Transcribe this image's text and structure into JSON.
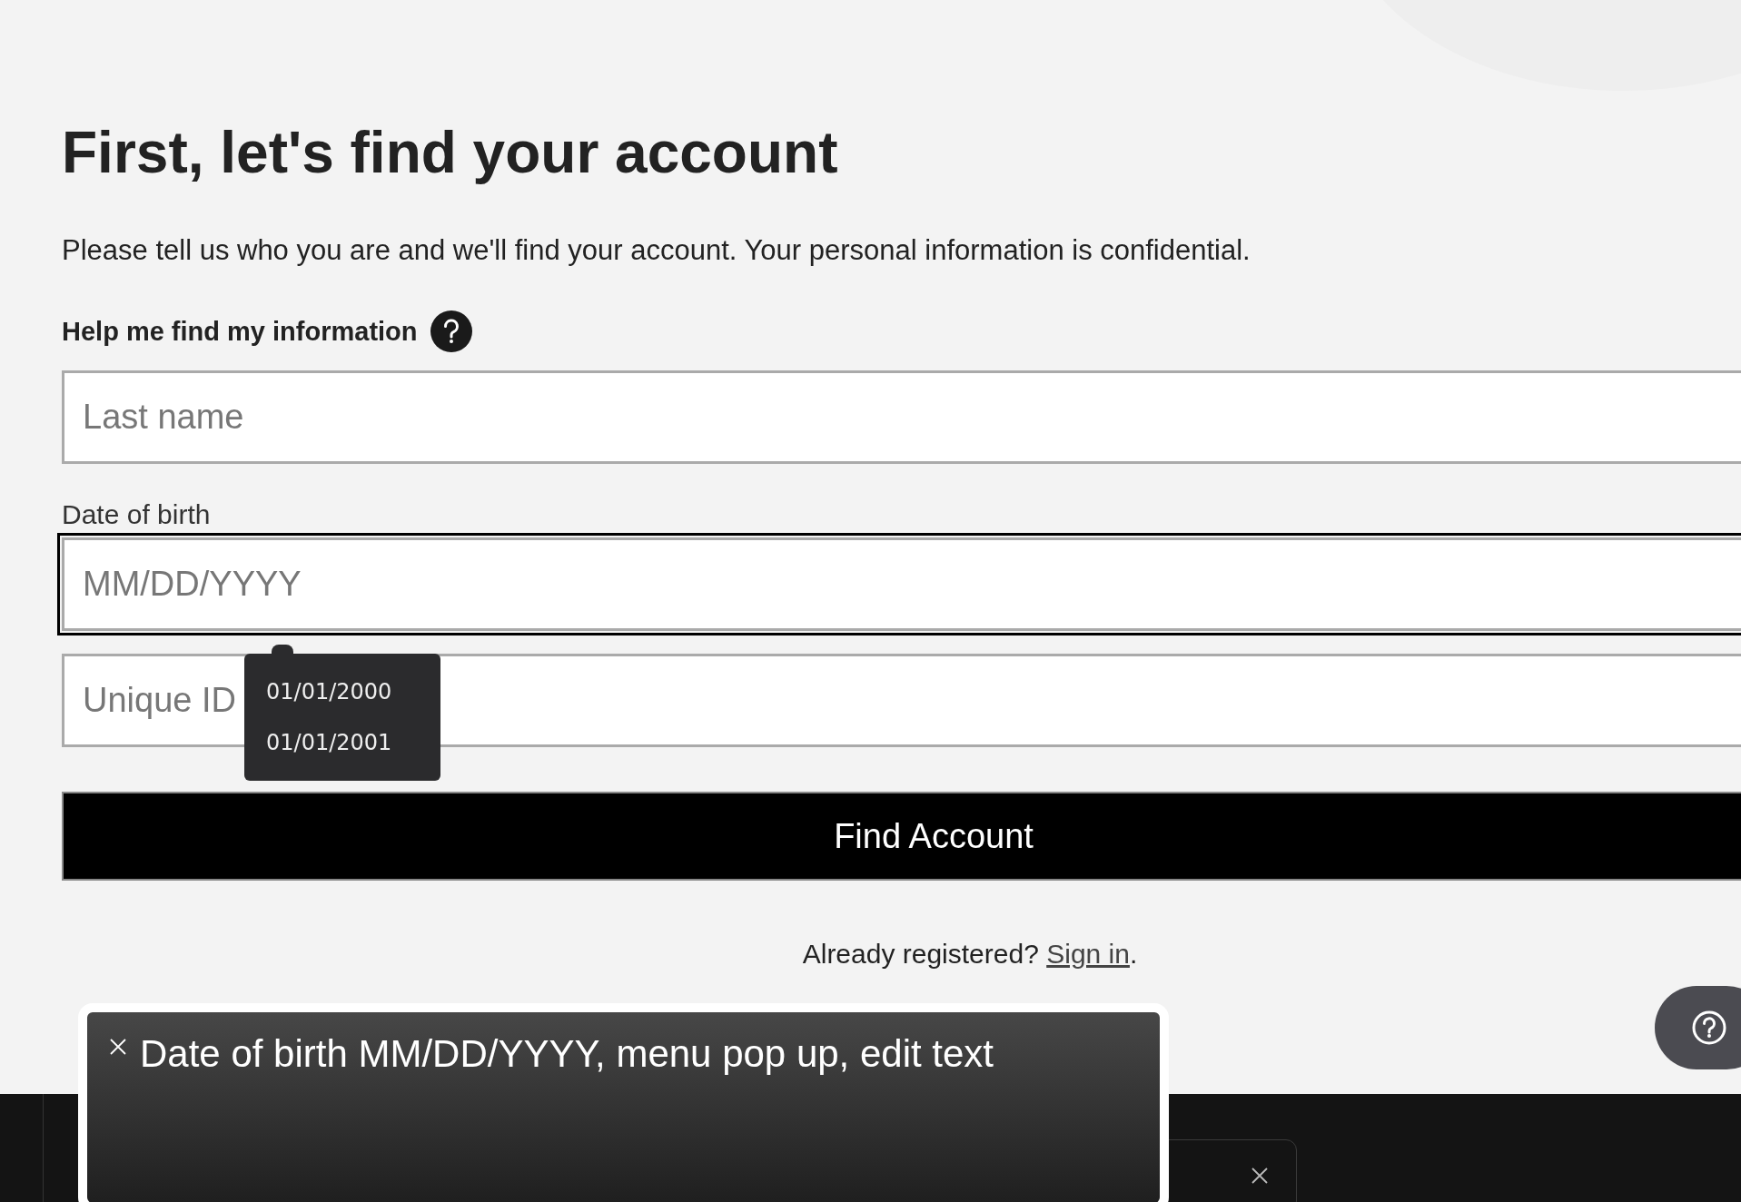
{
  "heading": "First, let's find your account",
  "intro": "Please tell us who you are and we'll find your account. Your personal information is confidential.",
  "help_label": "Help me find my information",
  "fields": [
    {
      "placeholder": "Last name",
      "focused": false
    },
    {
      "label": "Date of birth",
      "placeholder": "MM/DD/YYYY",
      "focused": true,
      "suggestions": [
        "01/01/2000",
        "01/01/2001"
      ]
    },
    {
      "placeholder": "Unique ID",
      "focused": false
    }
  ],
  "button": "Find Account",
  "signin": {
    "prompt": "Already registered?",
    "link": "Sign in",
    "trailing": "."
  },
  "caption": "Date of birth MM/DD/YYYY, menu pop up, edit text"
}
